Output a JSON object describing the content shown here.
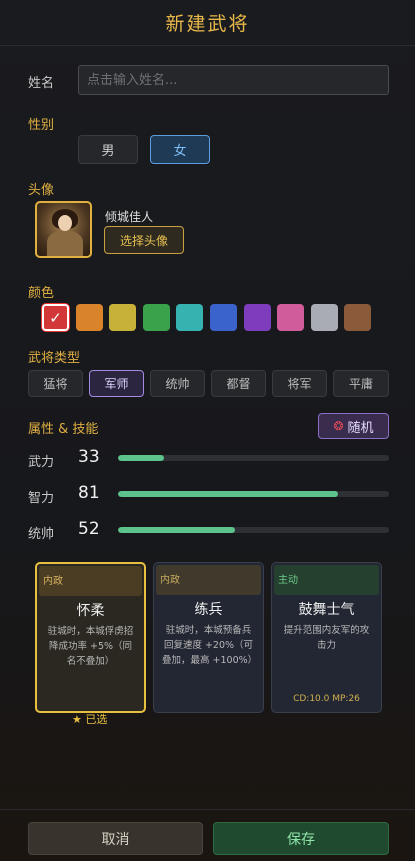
{
  "header": {
    "title": "新建武将"
  },
  "name": {
    "label": "姓名",
    "placeholder": "点击输入姓名...",
    "value": ""
  },
  "gender": {
    "label": "性别",
    "options": [
      "男",
      "女"
    ],
    "selected": "女"
  },
  "avatar": {
    "label": "头像",
    "caption": "倾城佳人",
    "choose_label": "选择头像"
  },
  "color": {
    "label": "颜色",
    "check_glyph": "✓",
    "swatches": [
      "#d23838",
      "#d9832a",
      "#c7b138",
      "#3aa24a",
      "#36b3b0",
      "#3b63cc",
      "#7d3dbd",
      "#d05c9c",
      "#a9acb4",
      "#8a5a3a"
    ],
    "selected_index": 0
  },
  "type": {
    "label": "武将类型",
    "options": [
      "猛将",
      "军师",
      "统帅",
      "都督",
      "将军",
      "平庸"
    ],
    "selected": "军师"
  },
  "attributes": {
    "label": "属性 & 技能",
    "random_label": "随机",
    "max": 100,
    "stats": [
      {
        "name": "武力",
        "value": "33",
        "fraction": 0.17
      },
      {
        "name": "智力",
        "value": "81",
        "fraction": 0.81
      },
      {
        "name": "统帅",
        "value": "52",
        "fraction": 0.43
      }
    ]
  },
  "skills": [
    {
      "tag": "内政",
      "name": "怀柔",
      "desc": "驻城时，本城俘虏招降成功率 +5%（同名不叠加）",
      "foot": "",
      "selected": true
    },
    {
      "tag": "内政",
      "name": "练兵",
      "desc": "驻城时，本城预备兵回复速度 +20%（可叠加，最高 +100%）",
      "foot": "",
      "selected": false
    },
    {
      "tag": "主动",
      "name": "鼓舞士气",
      "desc": "提升范围内友军的攻击力",
      "foot": "CD:10.0 MP:26",
      "selected": false
    }
  ],
  "chosen_label": "★ 已选",
  "footer": {
    "cancel_label": "取消",
    "save_label": "保存"
  }
}
